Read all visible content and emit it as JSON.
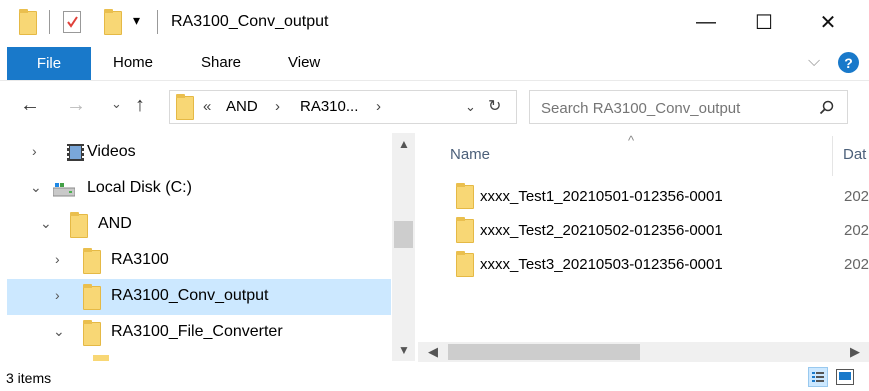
{
  "window": {
    "title": "RA3100_Conv_output",
    "minimize": "—",
    "maximize": "☐",
    "close": "✕"
  },
  "ribbon": {
    "tabs": [
      "File",
      "Home",
      "Share",
      "View"
    ],
    "expand_chevron": "⌵",
    "help": "?"
  },
  "address": {
    "crumb_prefix": "«",
    "crumbs": [
      "AND",
      "RA310..."
    ],
    "sep": "›",
    "search_placeholder": "Search RA3100_Conv_output"
  },
  "nav": {
    "items": [
      {
        "label": "Videos",
        "chevron": "›"
      },
      {
        "label": "Local Disk (C:)",
        "chevron": "⌄"
      },
      {
        "label": "AND",
        "chevron": "⌄"
      },
      {
        "label": "RA3100",
        "chevron": "›"
      },
      {
        "label": "RA3100_Conv_output",
        "chevron": "›"
      },
      {
        "label": "RA3100_File_Converter",
        "chevron": "⌄"
      }
    ]
  },
  "content": {
    "columns": [
      "Name",
      "Dat"
    ],
    "files": [
      {
        "name": "xxxx_Test1_20210501-012356-0001",
        "date": "202"
      },
      {
        "name": "xxxx_Test2_20210502-012356-0001",
        "date": "202"
      },
      {
        "name": "xxxx_Test3_20210503-012356-0001",
        "date": "202"
      }
    ]
  },
  "status": {
    "count": "3 items"
  },
  "colors": {
    "accent": "#1979ca",
    "selection": "#cce8ff",
    "folder": "#f8d775"
  }
}
